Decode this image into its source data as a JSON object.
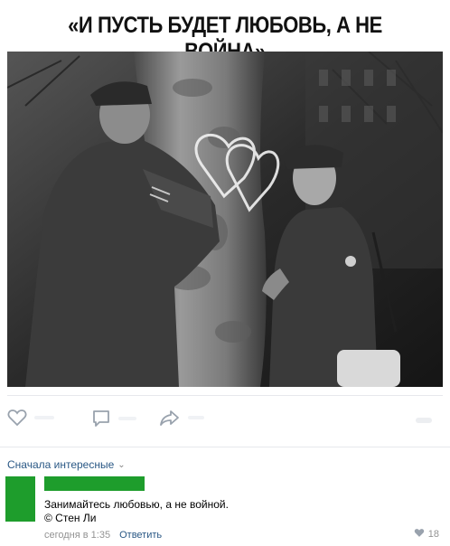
{
  "post": {
    "title": "«И ПУСТЬ БУДЕТ ЛЮБОВЬ, А НЕ ВОЙНА»"
  },
  "actions": {
    "like_icon": "heart-icon",
    "comment_icon": "comment-icon",
    "share_icon": "share-arrow-icon",
    "views_icon": "eye-icon"
  },
  "comments": {
    "sort_label": "Сначала интересные",
    "sort_icon": "chevron-down-icon",
    "items": [
      {
        "text_line1": "Занимайтесь любовью, а не войной.",
        "text_line2": "© Стен Ли",
        "time": "сегодня в 1:35",
        "reply_label": "Ответить",
        "likes": "18"
      }
    ]
  },
  "colors": {
    "link": "#2a5885",
    "redaction": "#1e9d2c",
    "meta": "#939393",
    "icon": "#99a2ad"
  }
}
